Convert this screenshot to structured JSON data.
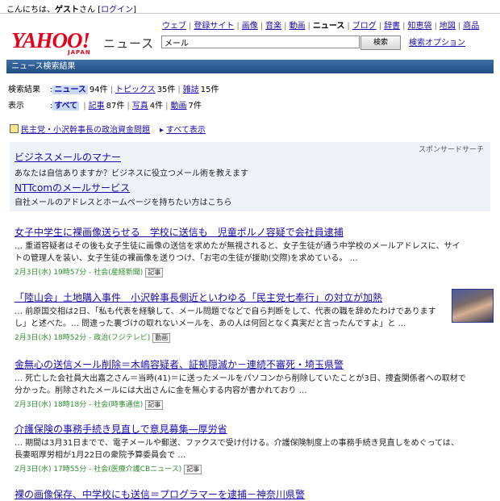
{
  "topbar": {
    "greeting": "こんにちは、",
    "user": "ゲスト",
    "suffix": "さん [",
    "login": "ログイン",
    "close": "]"
  },
  "logo": {
    "word": "YAHOO!",
    "sub": "JAPAN",
    "news": "ニュース"
  },
  "servnav": [
    "ウェブ",
    "登録サイト",
    "画像",
    "音楽",
    "動画",
    "ニュース",
    "ブログ",
    "辞書",
    "知恵袋",
    "地図",
    "商品"
  ],
  "search": {
    "value": "メール",
    "button": "検索",
    "option": "検索オプション"
  },
  "titlebar": "ニュース検索結果",
  "filters": {
    "results_label": "検索結果",
    "results": [
      {
        "label": "ニュース",
        "count": "94件",
        "active": true
      },
      {
        "label": "トピックス",
        "count": "35件"
      },
      {
        "label": "雑誌",
        "count": "15件"
      }
    ],
    "display_label": "表示",
    "display": [
      {
        "label": "すべて",
        "count": "",
        "active": true
      },
      {
        "label": "記事",
        "count": "87件"
      },
      {
        "label": "写真",
        "count": "4件"
      },
      {
        "label": "動画",
        "count": "7件"
      }
    ]
  },
  "related": {
    "topic": "民主党・小沢幹事長の政治資金問題",
    "show_all": "すべて表示"
  },
  "sponsor": {
    "tag": "スポンサードサーチ",
    "ads": [
      {
        "title": "ビジネスメールのマナー",
        "desc": "あなたは自信ありますか？ビジネスに役立つメール術を教えます"
      },
      {
        "title": "NTTcomのメールサービス",
        "desc": "自社メールのアドレスとホームページを持ちたい方はこちら"
      }
    ]
  },
  "results": [
    {
      "title": "女子中学生に裸画像送らせる　学校に送信も　児童ポルノ容疑で会社員逮捕",
      "snippet": "… 重道容疑者はその後も女子生徒に画像の送信を求めたが無視されると、女子生徒が通う中学校のメールアドレスに、サイトの管理人を装い、女子生徒の裸画像を送りつけ、「お宅の生徒が援助(交際)を求めている。 …",
      "meta": "2月3日(水) 19時57分 - 社会(産経新聞)",
      "badge": "記事"
    },
    {
      "title": "「陸山会」土地購入事件　小沢幹事長側近といわゆる「民主党七奉行」の対立が加熱",
      "snippet": "… 前原国交相は2日、「私も代表を経験して、メール問題でなどで自ら判断をして、代表の職を辞めたわけでありますし」と述べた。… 問違った裏づけの取れないメールを、あの人は何回となく真実だと言ったんですよ」と …",
      "meta": "2月3日(水) 18時52分 - 政治(フジテレビ)",
      "badge": "動画"
    },
    {
      "title": "金無心の送信メール削除＝木嶋容疑者、証拠隠滅か－連続不審死・埼玉県警",
      "snippet": "… 死亡した会社員大出嘉之さん＝当時(41)＝に送ったメールをパソコンから削除していたことが3日、捜査関係者への取材で分かった。削除されたメールには大出さんに金を無心する内容が書かれており …",
      "meta": "2月3日(水) 18時18分 - 社会(時事通信)",
      "badge": "記事"
    },
    {
      "title": "介護保険の事務手続き見直しで意見募集―厚労省",
      "snippet": "… 期間は3月31日までで、電子メールや郵送、ファクスで受け付ける。介護保険制度上の事務手続き見直しをめぐっては、長妻昭厚労相が1月22日の衆院予算委員会で …",
      "meta": "2月3日(水) 17時55分 - 社会(医療介護CBニュース)",
      "badge": "記事"
    },
    {
      "title": "裸の画像保存、中学校にも送信＝プログラマーを逮捕－神奈川県警",
      "snippet": "",
      "meta": "",
      "badge": ""
    }
  ]
}
